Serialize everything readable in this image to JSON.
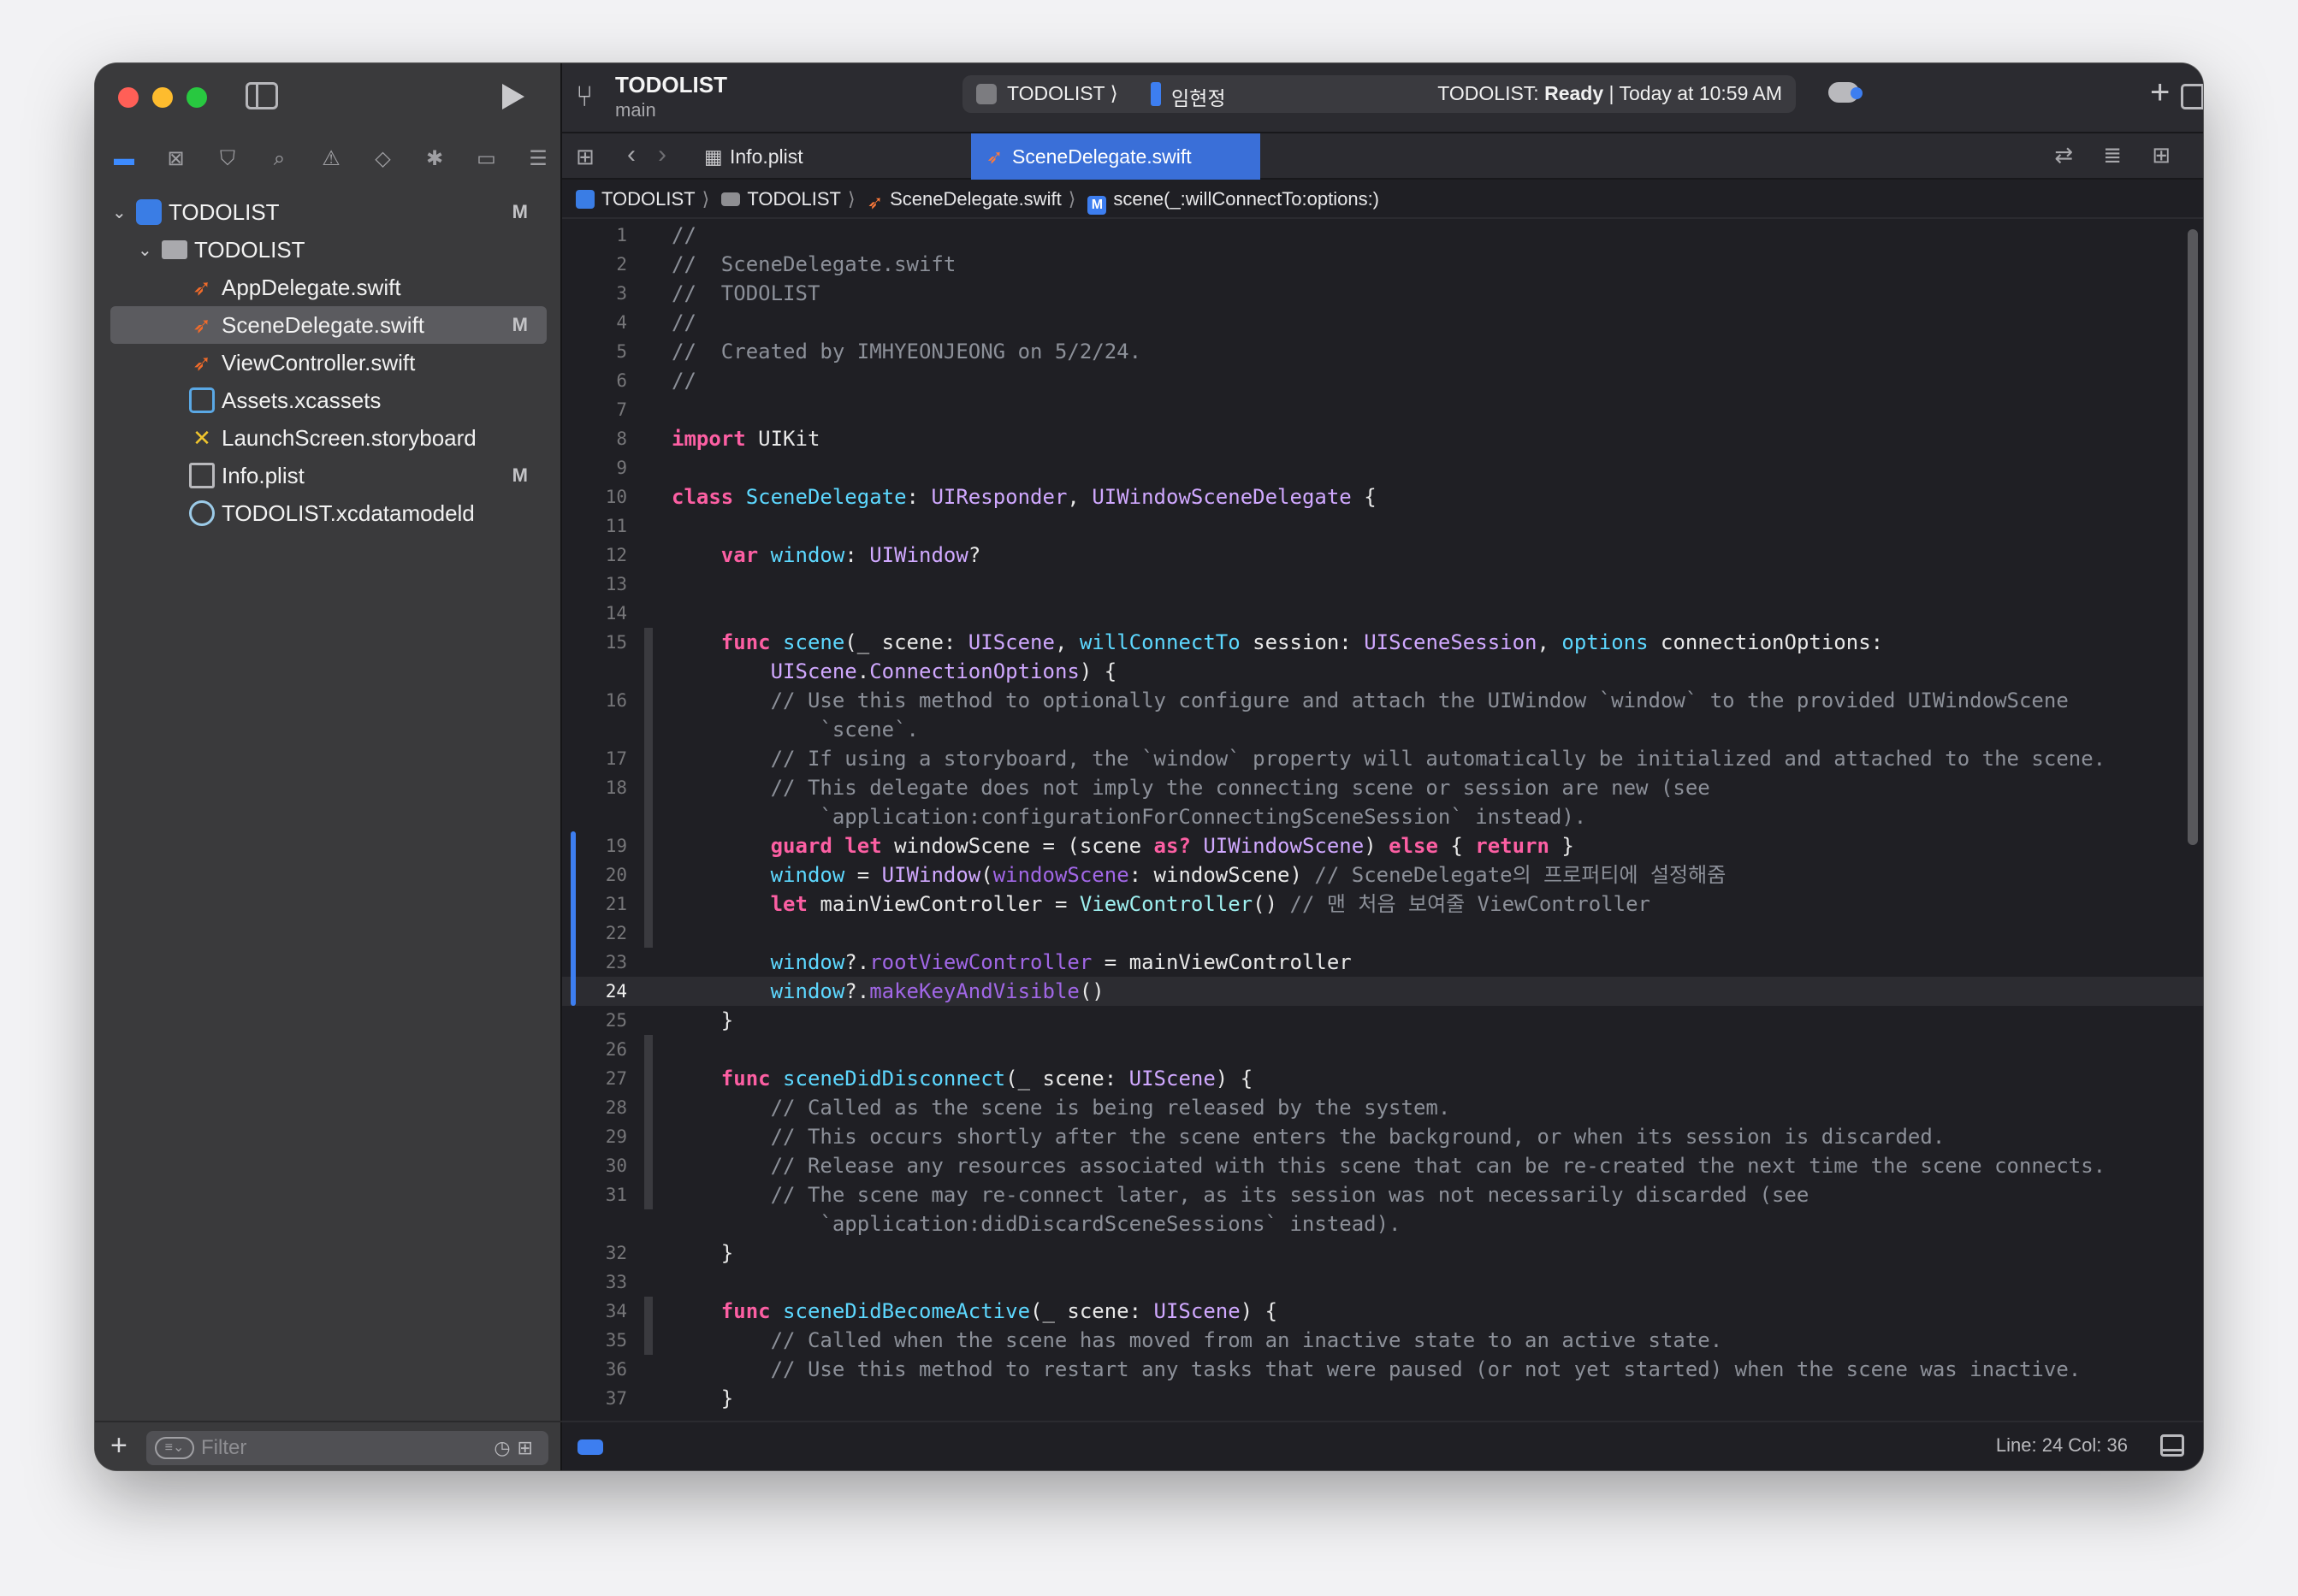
{
  "sidebar": {
    "nav_icons": [
      "folder-icon",
      "source-control-icon",
      "bookmark-icon",
      "search-icon",
      "warning-icon",
      "test-icon",
      "debug-icon",
      "breakpoint-icon",
      "report-icon"
    ],
    "tree": [
      {
        "label": "TODOLIST",
        "badge": "M",
        "icon": "project-icon",
        "depth": 0,
        "expanded": true
      },
      {
        "label": "TODOLIST",
        "badge": "",
        "icon": "folder-icon",
        "depth": 1,
        "expanded": true
      },
      {
        "label": "AppDelegate.swift",
        "badge": "",
        "icon": "swift-icon",
        "depth": 2
      },
      {
        "label": "SceneDelegate.swift",
        "badge": "M",
        "icon": "swift-icon",
        "depth": 2,
        "selected": true
      },
      {
        "label": "ViewController.swift",
        "badge": "",
        "icon": "swift-icon",
        "depth": 2
      },
      {
        "label": "Assets.xcassets",
        "badge": "",
        "icon": "assets-icon",
        "depth": 2
      },
      {
        "label": "LaunchScreen.storyboard",
        "badge": "",
        "icon": "storyboard-icon",
        "depth": 2
      },
      {
        "label": "Info.plist",
        "badge": "M",
        "icon": "plist-icon",
        "depth": 2
      },
      {
        "label": "TODOLIST.xcdatamodeld",
        "badge": "",
        "icon": "datamodel-icon",
        "depth": 2
      }
    ],
    "filter_placeholder": "Filter"
  },
  "toolbar": {
    "project": "TODOLIST",
    "branch": "main",
    "scheme": "TODOLIST ⟩",
    "device": "임현정",
    "status_prefix": "TODOLIST:",
    "status_state": "Ready",
    "status_time": "| Today at 10:59 AM"
  },
  "tabs": [
    {
      "label": "Info.plist",
      "active": false
    },
    {
      "label": "SceneDelegate.swift",
      "active": true
    }
  ],
  "breadcrumb": [
    "TODOLIST",
    "TODOLIST",
    "SceneDelegate.swift",
    "scene(_:willConnectTo:options:)"
  ],
  "editor": {
    "current_line": 24,
    "lines": [
      {
        "n": "1",
        "t": [
          [
            "c-com",
            "//"
          ]
        ]
      },
      {
        "n": "2",
        "t": [
          [
            "c-com",
            "//  SceneDelegate.swift"
          ]
        ]
      },
      {
        "n": "3",
        "t": [
          [
            "c-com",
            "//  TODOLIST"
          ]
        ]
      },
      {
        "n": "4",
        "t": [
          [
            "c-com",
            "//"
          ]
        ]
      },
      {
        "n": "5",
        "t": [
          [
            "c-com",
            "//  Created by IMHYEONJEONG on 5/2/24."
          ]
        ]
      },
      {
        "n": "6",
        "t": [
          [
            "c-com",
            "//"
          ]
        ]
      },
      {
        "n": "7",
        "t": []
      },
      {
        "n": "8",
        "t": [
          [
            "c-kw",
            "import"
          ],
          [
            "c-plain",
            " UIKit"
          ]
        ]
      },
      {
        "n": "9",
        "t": []
      },
      {
        "n": "10",
        "t": [
          [
            "c-kw",
            "class"
          ],
          [
            "c-plain",
            " "
          ],
          [
            "c-decl",
            "SceneDelegate"
          ],
          [
            "c-plain",
            ": "
          ],
          [
            "c-type",
            "UIResponder"
          ],
          [
            "c-plain",
            ", "
          ],
          [
            "c-type",
            "UIWindowSceneDelegate"
          ],
          [
            "c-plain",
            " {"
          ]
        ]
      },
      {
        "n": "11",
        "t": []
      },
      {
        "n": "12",
        "t": [
          [
            "c-plain",
            "    "
          ],
          [
            "c-kw",
            "var"
          ],
          [
            "c-plain",
            " "
          ],
          [
            "c-decl",
            "window"
          ],
          [
            "c-plain",
            ": "
          ],
          [
            "c-type",
            "UIWindow"
          ],
          [
            "c-plain",
            "?"
          ]
        ]
      },
      {
        "n": "13",
        "t": []
      },
      {
        "n": "14",
        "t": []
      },
      {
        "n": "15",
        "t": [
          [
            "c-plain",
            "    "
          ],
          [
            "c-kw",
            "func"
          ],
          [
            "c-plain",
            " "
          ],
          [
            "c-decl",
            "scene"
          ],
          [
            "c-plain",
            "(_ scene: "
          ],
          [
            "c-type",
            "UIScene"
          ],
          [
            "c-plain",
            ", "
          ],
          [
            "c-decl",
            "willConnectTo"
          ],
          [
            "c-plain",
            " session: "
          ],
          [
            "c-type",
            "UISceneSession"
          ],
          [
            "c-plain",
            ", "
          ],
          [
            "c-decl",
            "options"
          ],
          [
            "c-plain",
            " connectionOptions:"
          ]
        ]
      },
      {
        "n": "",
        "t": [
          [
            "c-plain",
            "        "
          ],
          [
            "c-type",
            "UIScene"
          ],
          [
            "c-plain",
            "."
          ],
          [
            "c-type",
            "ConnectionOptions"
          ],
          [
            "c-plain",
            ") {"
          ]
        ]
      },
      {
        "n": "16",
        "t": [
          [
            "c-com",
            "        // Use this method to optionally configure and attach the UIWindow `window` to the provided UIWindowScene"
          ]
        ]
      },
      {
        "n": "",
        "t": [
          [
            "c-com",
            "            `scene`."
          ]
        ]
      },
      {
        "n": "17",
        "t": [
          [
            "c-com",
            "        // If using a storyboard, the `window` property will automatically be initialized and attached to the scene."
          ]
        ]
      },
      {
        "n": "18",
        "t": [
          [
            "c-com",
            "        // This delegate does not imply the connecting scene or session are new (see"
          ]
        ]
      },
      {
        "n": "",
        "t": [
          [
            "c-com",
            "            `application:configurationForConnectingSceneSession` instead)."
          ]
        ]
      },
      {
        "n": "19",
        "t": [
          [
            "c-plain",
            "        "
          ],
          [
            "c-kw",
            "guard"
          ],
          [
            "c-plain",
            " "
          ],
          [
            "c-kw",
            "let"
          ],
          [
            "c-plain",
            " windowScene = (scene "
          ],
          [
            "c-kw",
            "as?"
          ],
          [
            "c-plain",
            " "
          ],
          [
            "c-type",
            "UIWindowScene"
          ],
          [
            "c-plain",
            ") "
          ],
          [
            "c-kw",
            "else"
          ],
          [
            "c-plain",
            " { "
          ],
          [
            "c-kw",
            "return"
          ],
          [
            "c-plain",
            " }"
          ]
        ]
      },
      {
        "n": "20",
        "t": [
          [
            "c-plain",
            "        "
          ],
          [
            "c-decl",
            "window"
          ],
          [
            "c-plain",
            " = "
          ],
          [
            "c-type",
            "UIWindow"
          ],
          [
            "c-plain",
            "("
          ],
          [
            "c-fn",
            "windowScene"
          ],
          [
            "c-plain",
            ": windowScene) "
          ],
          [
            "c-com",
            "// SceneDelegate의 프로퍼티에 설정해줌"
          ]
        ]
      },
      {
        "n": "21",
        "t": [
          [
            "c-plain",
            "        "
          ],
          [
            "c-kw",
            "let"
          ],
          [
            "c-plain",
            " mainViewController = "
          ],
          [
            "c-green",
            "ViewController"
          ],
          [
            "c-plain",
            "() "
          ],
          [
            "c-com",
            "// 맨 처음 보여줄 ViewController"
          ]
        ]
      },
      {
        "n": "22",
        "t": []
      },
      {
        "n": "23",
        "t": [
          [
            "c-plain",
            "        "
          ],
          [
            "c-decl",
            "window"
          ],
          [
            "c-plain",
            "?."
          ],
          [
            "c-fn",
            "rootViewController"
          ],
          [
            "c-plain",
            " = mainViewController"
          ]
        ]
      },
      {
        "n": "24",
        "t": [
          [
            "c-plain",
            "        "
          ],
          [
            "c-decl",
            "window"
          ],
          [
            "c-plain",
            "?."
          ],
          [
            "c-fn",
            "makeKeyAndVisible"
          ],
          [
            "c-plain",
            "()"
          ]
        ]
      },
      {
        "n": "25",
        "t": [
          [
            "c-plain",
            "    }"
          ]
        ]
      },
      {
        "n": "26",
        "t": []
      },
      {
        "n": "27",
        "t": [
          [
            "c-plain",
            "    "
          ],
          [
            "c-kw",
            "func"
          ],
          [
            "c-plain",
            " "
          ],
          [
            "c-decl",
            "sceneDidDisconnect"
          ],
          [
            "c-plain",
            "(_ scene: "
          ],
          [
            "c-type",
            "UIScene"
          ],
          [
            "c-plain",
            ") {"
          ]
        ]
      },
      {
        "n": "28",
        "t": [
          [
            "c-com",
            "        // Called as the scene is being released by the system."
          ]
        ]
      },
      {
        "n": "29",
        "t": [
          [
            "c-com",
            "        // This occurs shortly after the scene enters the background, or when its session is discarded."
          ]
        ]
      },
      {
        "n": "30",
        "t": [
          [
            "c-com",
            "        // Release any resources associated with this scene that can be re-created the next time the scene connects."
          ]
        ]
      },
      {
        "n": "31",
        "t": [
          [
            "c-com",
            "        // The scene may re-connect later, as its session was not necessarily discarded (see"
          ]
        ]
      },
      {
        "n": "",
        "t": [
          [
            "c-com",
            "            `application:didDiscardSceneSessions` instead)."
          ]
        ]
      },
      {
        "n": "32",
        "t": [
          [
            "c-plain",
            "    }"
          ]
        ]
      },
      {
        "n": "33",
        "t": []
      },
      {
        "n": "34",
        "t": [
          [
            "c-plain",
            "    "
          ],
          [
            "c-kw",
            "func"
          ],
          [
            "c-plain",
            " "
          ],
          [
            "c-decl",
            "sceneDidBecomeActive"
          ],
          [
            "c-plain",
            "(_ scene: "
          ],
          [
            "c-type",
            "UIScene"
          ],
          [
            "c-plain",
            ") {"
          ]
        ]
      },
      {
        "n": "35",
        "t": [
          [
            "c-com",
            "        // Called when the scene has moved from an inactive state to an active state."
          ]
        ]
      },
      {
        "n": "36",
        "t": [
          [
            "c-com",
            "        // Use this method to restart any tasks that were paused (or not yet started) when the scene was inactive."
          ]
        ]
      },
      {
        "n": "37",
        "t": [
          [
            "c-plain",
            "    }"
          ]
        ]
      }
    ]
  },
  "status_bar": {
    "position": "Line: 24  Col: 36"
  }
}
